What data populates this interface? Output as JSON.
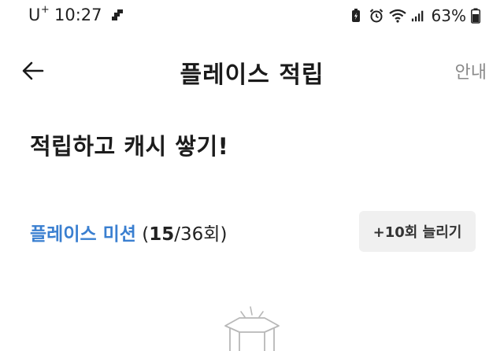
{
  "status_bar": {
    "carrier": "U",
    "carrier_sup": "+",
    "time": "10:27",
    "battery": "63%",
    "icons": [
      "notification-icon",
      "battery-saver-icon",
      "alarm-icon",
      "wifi-icon",
      "signal-icon",
      "battery-icon"
    ]
  },
  "header": {
    "title": "플레이스 적립",
    "guide_label": "안내",
    "back_icon": "arrow-left-icon"
  },
  "main": {
    "headline": "적립하고 캐시 쌓기!",
    "mission": {
      "name": "플레이스 미션",
      "open_paren": " (",
      "current": "15",
      "rest": "/36회)",
      "extend_button": "+10회 늘리기"
    },
    "illustration_icon": "empty-box-icon"
  },
  "colors": {
    "accent": "#3a7fd0",
    "text": "#1c1c1c",
    "muted": "#8a8a8a",
    "button_bg": "#f0f0f0"
  }
}
